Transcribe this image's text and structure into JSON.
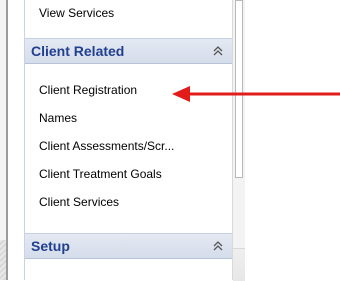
{
  "nav": {
    "previous_item": {
      "label": "View Services"
    },
    "client_related": {
      "title": "Client Related",
      "toggle_icon": "double-chevron-up-icon",
      "items": [
        {
          "label": "Client Registration"
        },
        {
          "label": "Names"
        },
        {
          "label": "Client Assessments/Scr..."
        },
        {
          "label": "Client Treatment Goals"
        },
        {
          "label": "Client Services"
        }
      ]
    },
    "setup": {
      "title": "Setup",
      "toggle_icon": "double-chevron-up-icon"
    }
  },
  "annotation": {
    "arrow_icon": "red-arrow-left-icon",
    "color": "#e21b1b"
  },
  "colors": {
    "section_title": "#213f8f",
    "section_bg": "#dbe2ef",
    "panel_border": "#c9d3e3"
  }
}
